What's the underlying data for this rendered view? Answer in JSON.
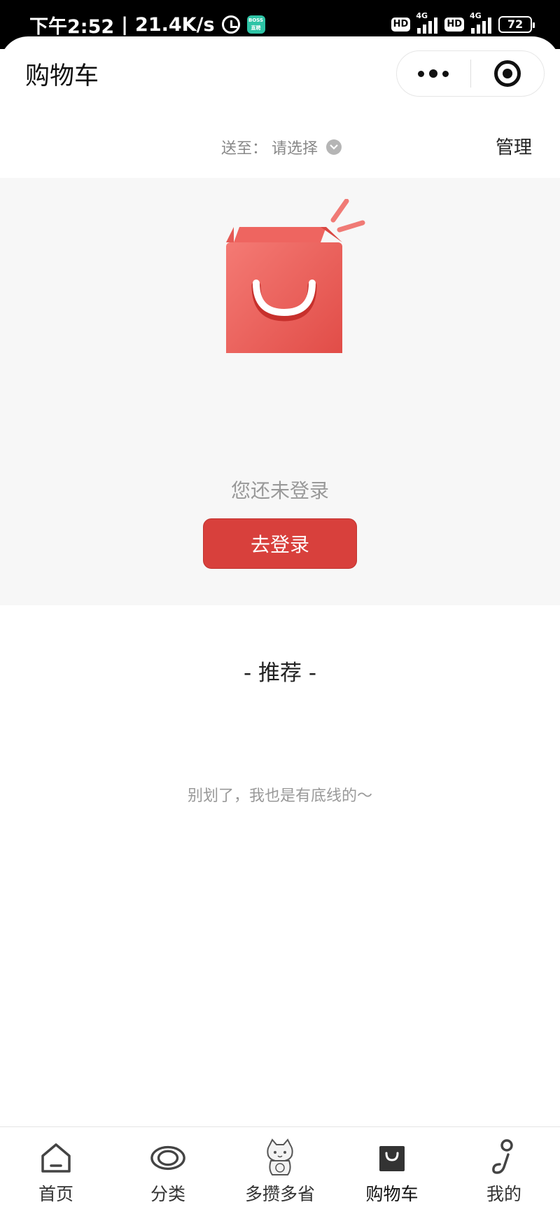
{
  "status_bar": {
    "time": "下午2:52",
    "separator": "|",
    "net_speed": "21.4K/s",
    "boss_app_icon": "boss-zhipin-icon",
    "boss_lines": [
      "BOSS",
      "直聘"
    ],
    "hd_label": "HD",
    "network": "4G",
    "battery": "72"
  },
  "header": {
    "title": "购物车"
  },
  "address": {
    "label": "送至：",
    "value": "请选择",
    "manage": "管理"
  },
  "empty_state": {
    "icon": "shopping-bag-icon",
    "message": "您还未登录",
    "login_button": "去登录"
  },
  "recommend": {
    "title": "- 推荐 -",
    "end_text": "别划了，我也是有底线的～"
  },
  "tabbar": {
    "items": [
      {
        "label": "首页",
        "icon": "home-icon"
      },
      {
        "label": "分类",
        "icon": "eye-icon"
      },
      {
        "label": "多攒多省",
        "icon": "lucky-cat-icon"
      },
      {
        "label": "购物车",
        "icon": "cart-bag-icon",
        "active": true
      },
      {
        "label": "我的",
        "icon": "profile-icon"
      }
    ]
  },
  "colors": {
    "accent": "#d8403c",
    "background": "#f7f7f7"
  }
}
